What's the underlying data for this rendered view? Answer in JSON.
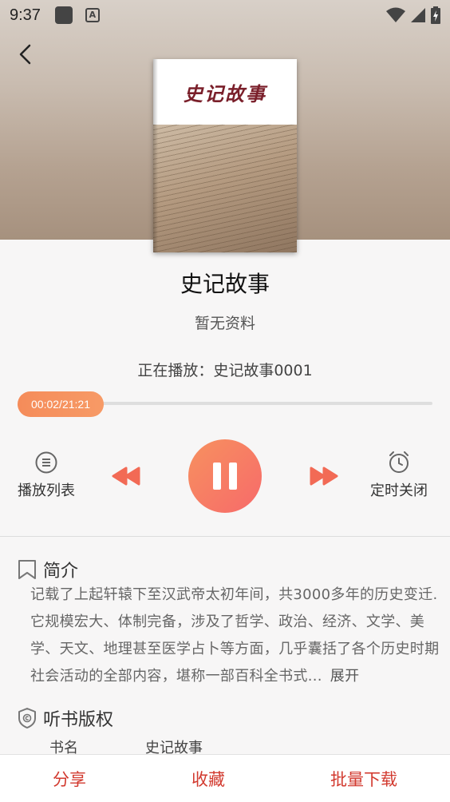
{
  "status_bar": {
    "time": "9:37"
  },
  "book": {
    "cover_title": "史记故事",
    "title": "史记故事",
    "author": "暂无资料"
  },
  "player": {
    "now_playing_label": "正在播放：",
    "now_playing_track": "史记故事0001",
    "elapsed": "00:02",
    "duration": "21:21",
    "time_display": "00:02/21:21",
    "progress_fraction": 0.002,
    "playlist_label": "播放列表",
    "timer_label": "定时关闭",
    "state": "playing"
  },
  "intro": {
    "heading": "简介",
    "text": "记载了上起轩辕下至汉武帝太初年间，共3000多年的历史变迁.它规模宏大、体制完备，涉及了哲学、政治、经济、文学、美学、天文、地理甚至医学占卜等方面，几乎囊括了各个历史时期社会活动的全部内容，堪称一部百科全书式...",
    "expand_label": "展开"
  },
  "copyright": {
    "heading": "听书版权",
    "rows": [
      {
        "key": "书名",
        "value": "史记故事"
      }
    ]
  },
  "bottom_bar": {
    "share": "分享",
    "favorite": "收藏",
    "batch_download": "批量下载"
  },
  "colors": {
    "accent_orange": "#f58c5a",
    "accent_red": "#d23a2f",
    "cover_title": "#7a1f2a"
  },
  "icons": [
    "back-arrow-icon",
    "playlist-icon",
    "rewind-icon",
    "pause-icon",
    "fast-forward-icon",
    "alarm-clock-icon",
    "bookmark-icon",
    "copyright-shield-icon",
    "wifi-icon",
    "signal-icon",
    "battery-icon"
  ]
}
